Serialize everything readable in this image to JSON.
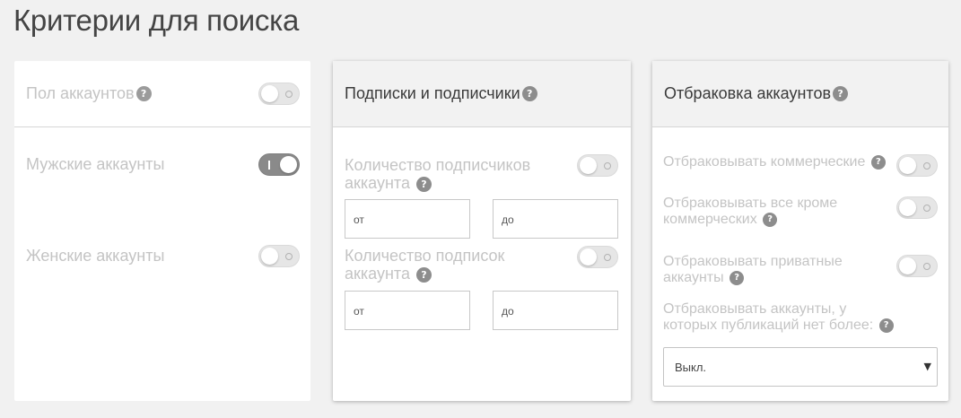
{
  "page": {
    "title": "Критерии для поиска"
  },
  "gender_card": {
    "header": "Пол аккаунтов",
    "header_toggle_on": false,
    "male_label": "Мужские аккаунты",
    "male_toggle_on": true,
    "female_label": "Женские аккаунты",
    "female_toggle_on": false
  },
  "followers_card": {
    "header": "Подписки и подписчики",
    "followers_count": {
      "label_line1": "Количество подписчиков",
      "label_line2": "аккаунта",
      "toggle_on": false,
      "from_placeholder": "от",
      "to_placeholder": "до"
    },
    "following_count": {
      "label_line1": "Количество подписок",
      "label_line2": "аккаунта",
      "toggle_on": false,
      "from_placeholder": "от",
      "to_placeholder": "до"
    }
  },
  "filter_card": {
    "header": "Отбраковка аккаунтов",
    "reject_commercial": {
      "label": "Отбраковывать коммерческие",
      "toggle_on": false
    },
    "reject_non_commercial": {
      "label_line1": "Отбраковывать все кроме",
      "label_line2": "коммерческих",
      "toggle_on": false
    },
    "reject_private": {
      "label_line1": "Отбраковывать приватные",
      "label_line2": "аккаунты",
      "toggle_on": false
    },
    "reject_no_posts": {
      "label_line1": "Отбраковывать аккаунты, у",
      "label_line2": "которых публикаций нет более:",
      "selected": "Выкл."
    }
  },
  "icons": {
    "help": "?",
    "dropdown_arrow": "▼"
  },
  "colors": {
    "background": "#f1f1f1",
    "card": "#ffffff",
    "toggle_on": "#8a8a8a",
    "help_icon": "#8d8d8d"
  }
}
